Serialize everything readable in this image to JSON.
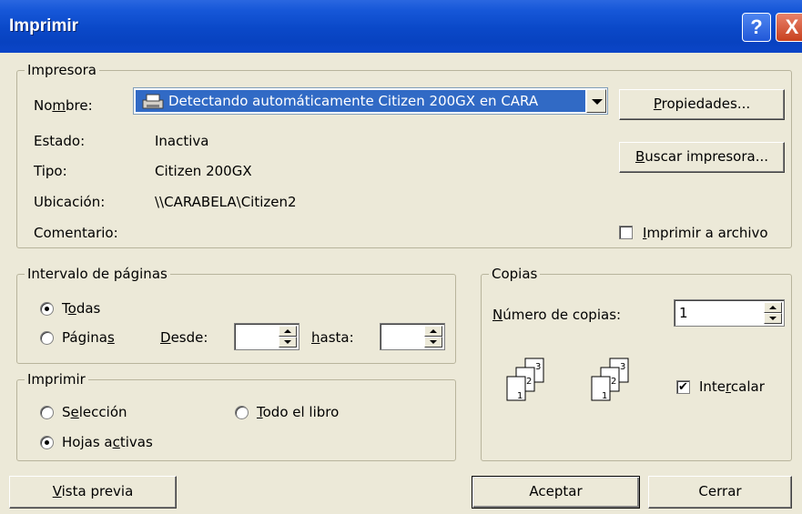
{
  "window": {
    "title": "Imprimir",
    "help_label": "?",
    "close_label": "X"
  },
  "printer": {
    "legend": "Impresora",
    "name_label_pre": "No",
    "name_label_key": "m",
    "name_label_post": "bre:",
    "name_value": "Detectando automáticamente Citizen 200GX en CARA",
    "status_label": "Estado:",
    "status_value": "Inactiva",
    "type_label": "Tipo:",
    "type_value": "Citizen 200GX",
    "location_label": "Ubicación:",
    "location_value": "\\\\CARABELA\\Citizen2",
    "comment_label": "Comentario:",
    "properties_key": "P",
    "properties_rest": "ropiedades...",
    "find_key": "B",
    "find_rest": "uscar impresora...",
    "print_to_file_key": "I",
    "print_to_file_rest": "mprimir a archivo",
    "print_to_file_checked": false
  },
  "page_range": {
    "legend": "Intervalo de páginas",
    "all_pre": "T",
    "all_key": "o",
    "all_post": "das",
    "all_selected": true,
    "pages_pre": "Página",
    "pages_key": "s",
    "pages_selected": false,
    "from_key": "D",
    "from_rest": "esde:",
    "from_value": "",
    "to_key": "h",
    "to_rest": "asta:",
    "to_value": ""
  },
  "print_what": {
    "legend": "Imprimir",
    "selection_pre": "S",
    "selection_key": "e",
    "selection_post": "lección",
    "selection_selected": false,
    "workbook_key": "T",
    "workbook_rest": "odo el libro",
    "workbook_selected": false,
    "active_sheets_pre": "Hojas a",
    "active_sheets_key": "c",
    "active_sheets_post": "tivas",
    "active_sheets_selected": true
  },
  "copies": {
    "legend": "Copias",
    "number_key": "N",
    "number_rest": "úmero de copias:",
    "number_value": "1",
    "collate_pre": "Inte",
    "collate_key": "r",
    "collate_post": "calar",
    "collate_checked": true,
    "icon_page_labels": [
      "1",
      "2",
      "3"
    ]
  },
  "footer": {
    "preview_key": "V",
    "preview_rest": "ista previa",
    "ok_label": "Aceptar",
    "close_label": "Cerrar"
  }
}
